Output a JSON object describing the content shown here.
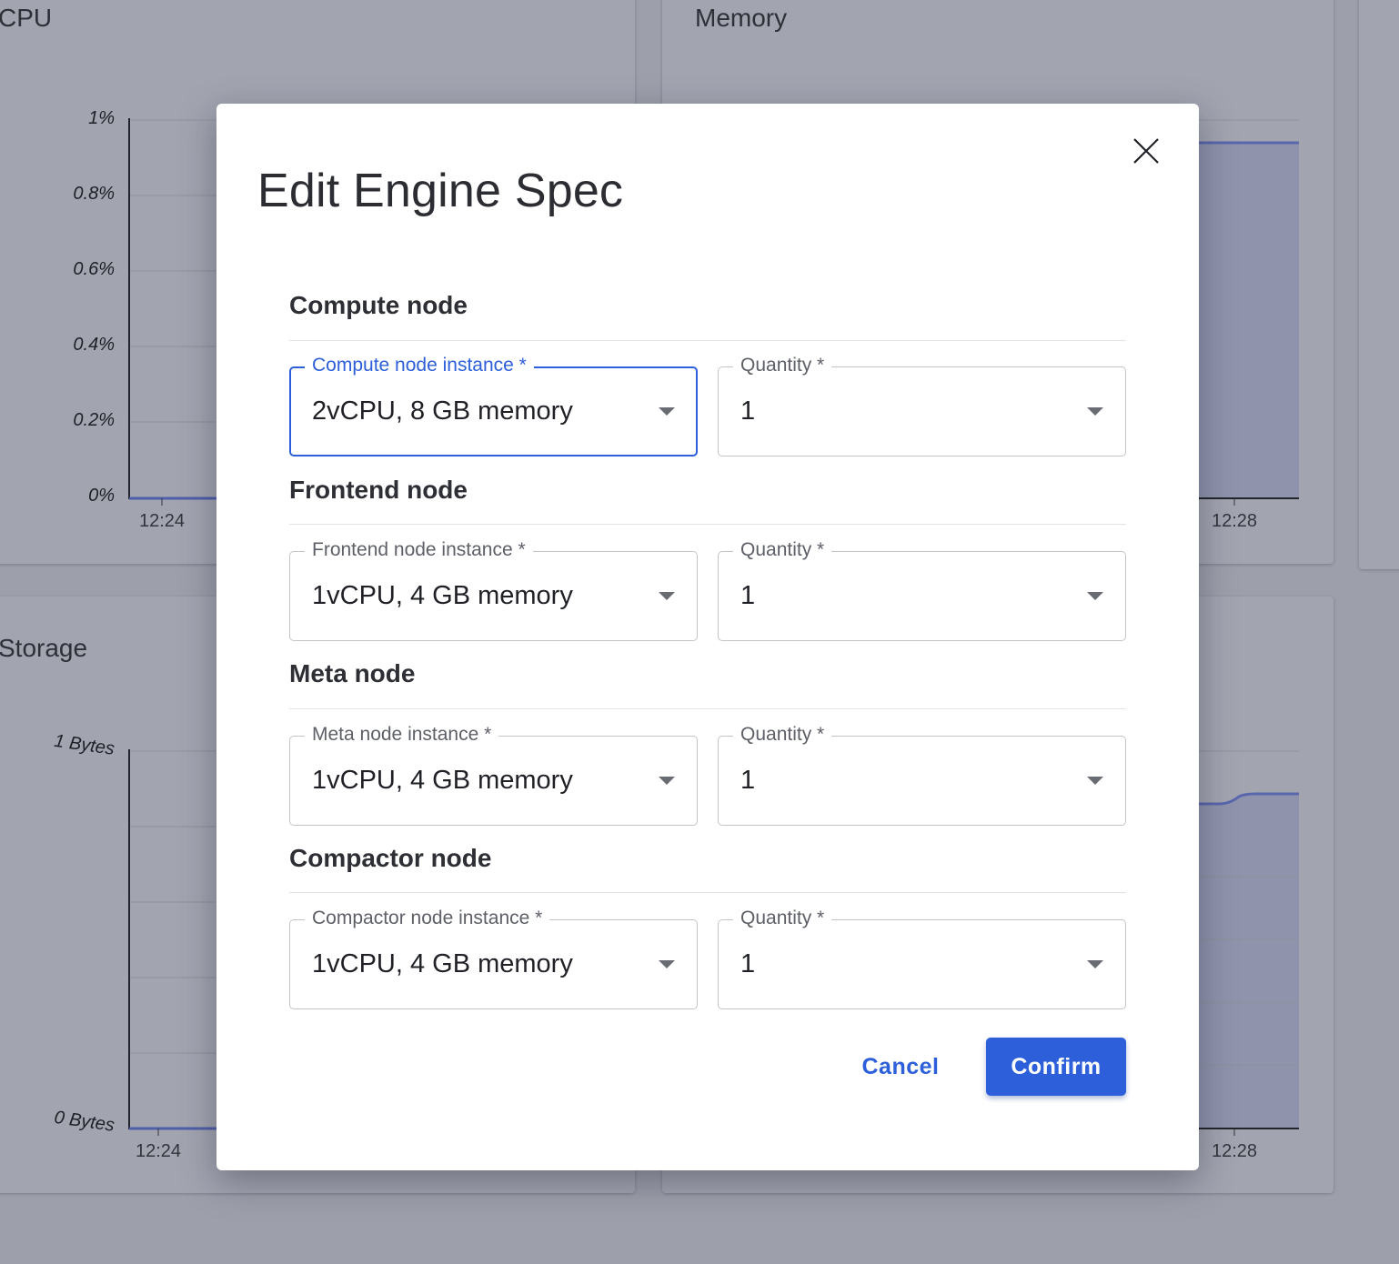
{
  "background": {
    "cpu": {
      "title": "CPU",
      "y_ticks": [
        "1%",
        "0.8%",
        "0.6%",
        "0.4%",
        "0.2%",
        "0%"
      ],
      "x_ticks": [
        "12:24"
      ]
    },
    "memory": {
      "title": "Memory",
      "x_ticks": [
        "12:28"
      ]
    },
    "storage": {
      "title": "Storage",
      "y_ticks": [
        "1 Bytes",
        "0 Bytes"
      ],
      "x_ticks": [
        "12:24"
      ]
    },
    "fourth": {
      "x_ticks": [
        "12:28"
      ]
    }
  },
  "dialog": {
    "title": "Edit Engine Spec",
    "close_icon": "close-icon",
    "sections": [
      {
        "title": "Compute node",
        "instance_label": "Compute node instance *",
        "instance_value": "2vCPU, 8 GB memory",
        "quantity_label": "Quantity *",
        "quantity_value": "1"
      },
      {
        "title": "Frontend node",
        "instance_label": "Frontend node instance *",
        "instance_value": "1vCPU, 4 GB memory",
        "quantity_label": "Quantity *",
        "quantity_value": "1"
      },
      {
        "title": "Meta node",
        "instance_label": "Meta node instance *",
        "instance_value": "1vCPU, 4 GB memory",
        "quantity_label": "Quantity *",
        "quantity_value": "1"
      },
      {
        "title": "Compactor node",
        "instance_label": "Compactor node instance *",
        "instance_value": "1vCPU, 4 GB memory",
        "quantity_label": "Quantity *",
        "quantity_value": "1"
      }
    ],
    "cancel_label": "Cancel",
    "confirm_label": "Confirm"
  },
  "colors": {
    "accent": "#2c5fd9",
    "overlay": "#9d9fab"
  }
}
